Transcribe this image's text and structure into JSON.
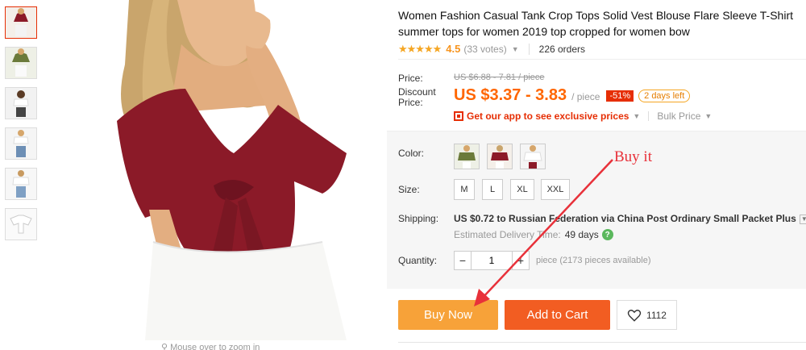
{
  "product": {
    "title": "Women Fashion Casual Tank Crop Tops Solid Vest Blouse Flare Sleeve T-Shirt summer tops for women 2019 top cropped for women bow",
    "stars": "★★★★★",
    "rating": "4.5",
    "votes": "(33 votes)",
    "orders": "226 orders",
    "zoom_hint": "Mouse over to zoom in"
  },
  "price": {
    "label": "Price:",
    "original": "US $6.88 - 7.81 / piece",
    "discount_label": "Discount Price:",
    "current": "US $3.37 - 3.83",
    "unit": "/ piece",
    "discount_badge": "-51%",
    "days_left": "2 days left",
    "app_promo": "Get our app to see exclusive prices",
    "bulk": "Bulk Price"
  },
  "options": {
    "color_label": "Color:",
    "size_label": "Size:",
    "sizes": [
      "M",
      "L",
      "XL",
      "XXL"
    ],
    "shipping_label": "Shipping:",
    "shipping_text": "US $0.72 to Russian Federation via China Post Ordinary Small Packet Plus",
    "estimated_label": "Estimated Delivery Time:",
    "estimated_days": "49 days",
    "quantity_label": "Quantity:",
    "quantity_value": "1",
    "quantity_note": "piece (2173 pieces available)"
  },
  "actions": {
    "buy_now": "Buy Now",
    "add_to_cart": "Add to Cart",
    "wishlist_count": "1112"
  },
  "annotation": {
    "text": "Buy it"
  },
  "colors": {
    "accent_red": "#e62e04",
    "price_orange": "#ff6600",
    "buy_now_bg": "#f7a239",
    "add_cart_bg": "#f25d22",
    "annotation_red": "#e8313a",
    "top_wine": "#8b1a28",
    "top_green": "#6b7a3a"
  }
}
